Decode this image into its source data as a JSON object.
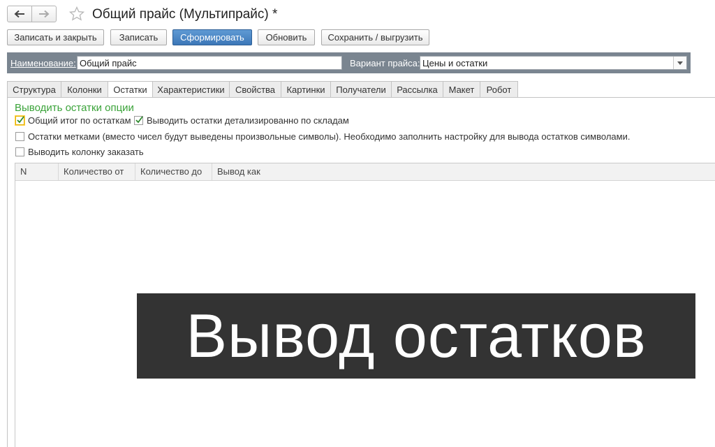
{
  "window": {
    "title": "Общий прайс (Мультипрайс) *"
  },
  "toolbar": {
    "save_close": "Записать и закрыть",
    "save": "Записать",
    "generate": "Сформировать",
    "refresh": "Обновить",
    "export": "Сохранить / выгрузить"
  },
  "header": {
    "name_label": "Наименование:",
    "name_value": "Общий прайс",
    "variant_label": "Вариант прайса:",
    "variant_value": "Цены и остатки"
  },
  "tabs": [
    "Структура",
    "Колонки",
    "Остатки",
    "Характеристики",
    "Свойства",
    "Картинки",
    "Получатели",
    "Рассылка",
    "Макет",
    "Робот"
  ],
  "active_tab": "Остатки",
  "options": {
    "section_title": "Выводить остатки опции",
    "total_by_stock": {
      "label": "Общий итог по остаткам",
      "checked": true
    },
    "detail_by_warehouse": {
      "label": "Выводить остатки детализированно по складам",
      "checked": true
    },
    "stock_marks": {
      "label": "Остатки метками (вместо чисел будут выведены произвольные символы). Необходимо заполнить настройку для вывода остатков символами.",
      "checked": false
    },
    "order_column": {
      "label": "Выводить колонку заказать",
      "checked": false
    }
  },
  "table": {
    "columns": [
      "N",
      "Количество от",
      "Количество до",
      "Вывод как"
    ]
  },
  "banner": {
    "text": "Вывод остатков"
  },
  "colors": {
    "primary_button": "#3c77b8",
    "section_title": "#3aa339",
    "header_panel": "#7a8590",
    "banner_bg": "#333333"
  }
}
